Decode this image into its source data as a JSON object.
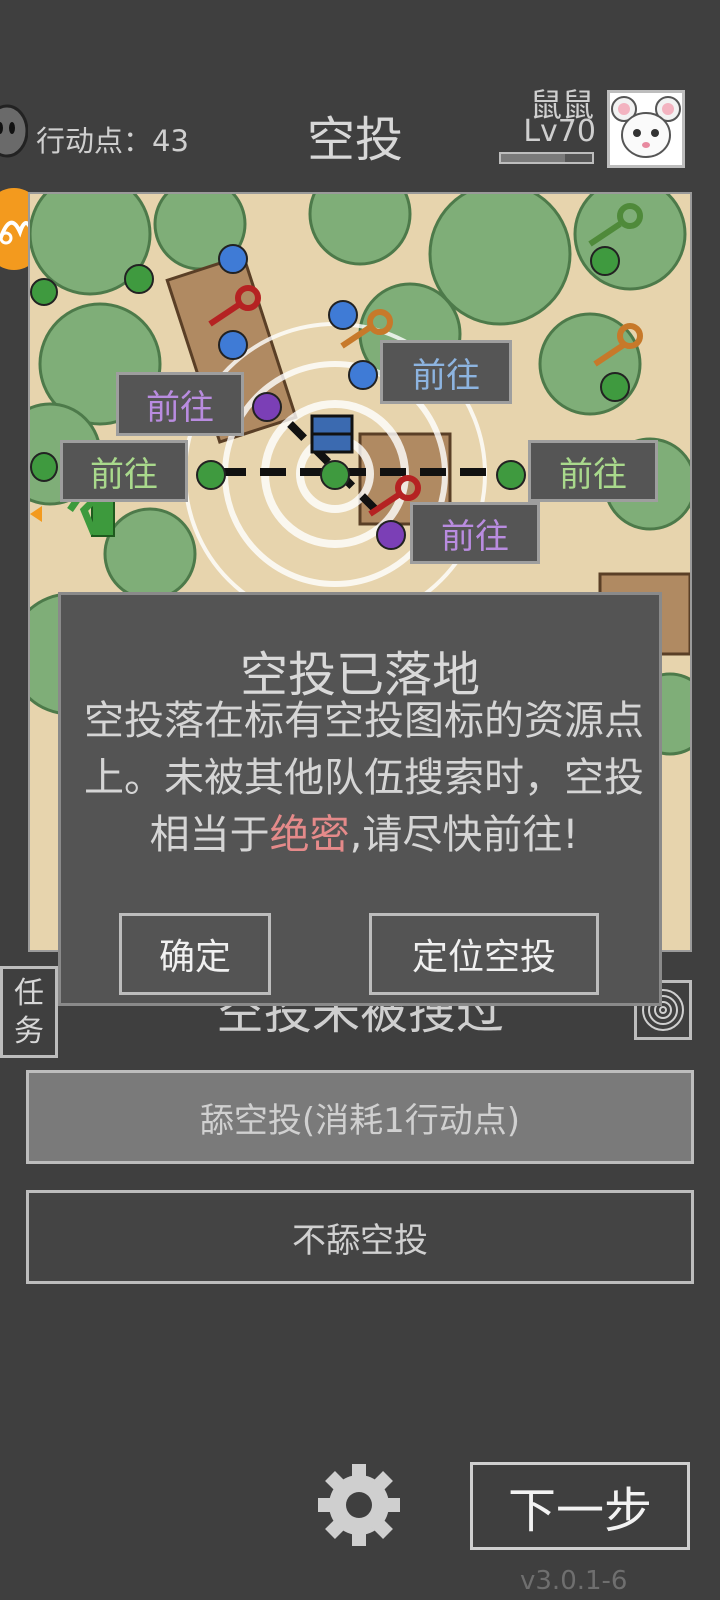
{
  "header": {
    "action_points_label": "行动点：",
    "action_points_value": "43",
    "title": "空投",
    "player_name": "鼠鼠",
    "player_level": "Lv70"
  },
  "map": {
    "go_buttons": [
      "前往",
      "前往",
      "前往",
      "前往",
      "前往"
    ]
  },
  "side": {
    "task_label": "任务"
  },
  "behind_modal_text": "空投未被搜过",
  "modal": {
    "title": "空投已落地",
    "body_before": "空投落在标有空投图标的资源点上。未被其他队伍搜索时，空投相当于",
    "body_highlight": "绝密",
    "body_after": ",请尽快前往!",
    "confirm_label": "确定",
    "locate_label": "定位空投"
  },
  "actions": {
    "lick_label": "舔空投(消耗1行动点)",
    "skip_label": "不舔空投"
  },
  "footer": {
    "next_label": "下一步",
    "version": "v3.0.1-6"
  },
  "colors": {
    "background": "#3f3f3f",
    "highlight": "#e58a8a",
    "orange_badge": "#f39a1e",
    "go_purple": "#b98ce0",
    "go_blue": "#8db4e0",
    "go_green": "#a9d98c"
  }
}
